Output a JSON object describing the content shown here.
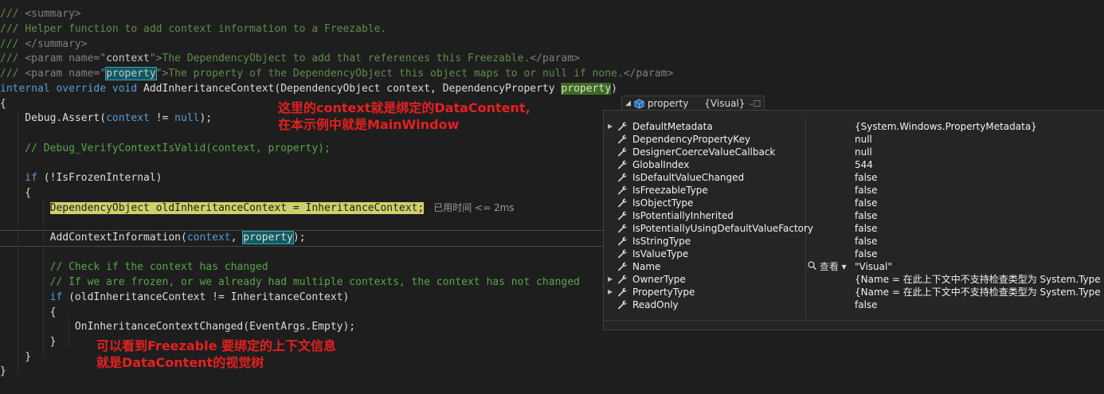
{
  "code": {
    "l1": "/// ",
    "l1_tag": "<summary>",
    "l2": "/// Helper function to add context information to a Freezable.",
    "l3": "/// ",
    "l3_tag": "</summary>",
    "l4_a": "/// ",
    "l4_b": "<param name=\"",
    "l4_c": "context",
    "l4_d": "\">",
    "l4_e": "The DependencyObject to add that references this Freezable.",
    "l4_f": "</param>",
    "l5_a": "/// ",
    "l5_b": "<param name=\"",
    "l5_c": "property",
    "l5_d": "\">",
    "l5_e": "The property of the DependencyObject this object maps to or null if none.",
    "l5_f": "</param>",
    "l6_kw": "internal override void",
    "l6_name": " AddInheritanceContext(",
    "l6_t1": "DependencyObject",
    "l6_p1": " context, ",
    "l6_t2": "DependencyProperty",
    "l6_sp": " ",
    "l6_p2": "property",
    "l6_end": ")",
    "l7": "{",
    "l8_a": "    Debug.Assert(",
    "l8_b": "context",
    "l8_c": " != ",
    "l8_d": "null",
    "l8_e": ");",
    "l9": "    // Debug_VerifyContextIsValid(context, property);",
    "l10_kw": "    if",
    "l10_rest": " (!IsFrozenInternal)",
    "l11": "    {",
    "l12_pad": "        ",
    "l12_stmt": "DependencyObject oldInheritanceContext = InheritanceContext;",
    "l12_elapsed": "已用时间 <= 2ms",
    "l13_a": "        AddContextInformation(",
    "l13_b": "context",
    "l13_c": ", ",
    "l13_d": "property",
    "l13_e": ");",
    "l14": "        // Check if the context has changed",
    "l15": "        // If we are frozen, or we already had multiple contexts, the context has not changed",
    "l16_kw": "        if",
    "l16_rest": " (oldInheritanceContext != InheritanceContext)",
    "l17": "        {",
    "l18": "            OnInheritanceContextChanged(EventArgs.Empty);",
    "l19": "        }",
    "l20": "    }",
    "l21": "}"
  },
  "annotations": {
    "top_1a": "这里的",
    "top_1b": "context",
    "top_1c": "就是绑定的",
    "top_1d": "DataContent,",
    "top_2a": "在本示例中就是",
    "top_2b": "MainWindow",
    "bottom_1a": "可以看到",
    "bottom_1b": "Freezable",
    "bottom_1c": " 要绑定的上下文信息",
    "bottom_2a": "就是",
    "bottom_2b": "DataContent",
    "bottom_2c": "的视觉树"
  },
  "datatip": {
    "name": "property",
    "value": "{Visual}",
    "pin": "-☐",
    "viewer_label": "查看",
    "rows": [
      {
        "name": "DefaultMetadata",
        "value": "{System.Windows.PropertyMetadata}",
        "expandable": true
      },
      {
        "name": "DependencyPropertyKey",
        "value": "null",
        "expandable": false
      },
      {
        "name": "DesignerCoerceValueCallback",
        "value": "null",
        "expandable": false
      },
      {
        "name": "GlobalIndex",
        "value": "544",
        "expandable": false
      },
      {
        "name": "IsDefaultValueChanged",
        "value": "false",
        "expandable": false
      },
      {
        "name": "IsFreezableType",
        "value": "false",
        "expandable": false
      },
      {
        "name": "IsObjectType",
        "value": "false",
        "expandable": false
      },
      {
        "name": "IsPotentiallyInherited",
        "value": "false",
        "expandable": false
      },
      {
        "name": "IsPotentiallyUsingDefaultValueFactory",
        "value": "false",
        "expandable": false
      },
      {
        "name": "IsStringType",
        "value": "false",
        "expandable": false
      },
      {
        "name": "IsValueType",
        "value": "false",
        "expandable": false
      },
      {
        "name": "Name",
        "value": "\"Visual\"",
        "expandable": false
      },
      {
        "name": "OwnerType",
        "value": "{Name = 在此上下文中不支持检查类型为 System.Type 的",
        "expandable": true
      },
      {
        "name": "PropertyType",
        "value": "{Name = 在此上下文中不支持检查类型为 System.Type 的",
        "expandable": true
      },
      {
        "name": "ReadOnly",
        "value": "false",
        "expandable": false
      }
    ]
  }
}
